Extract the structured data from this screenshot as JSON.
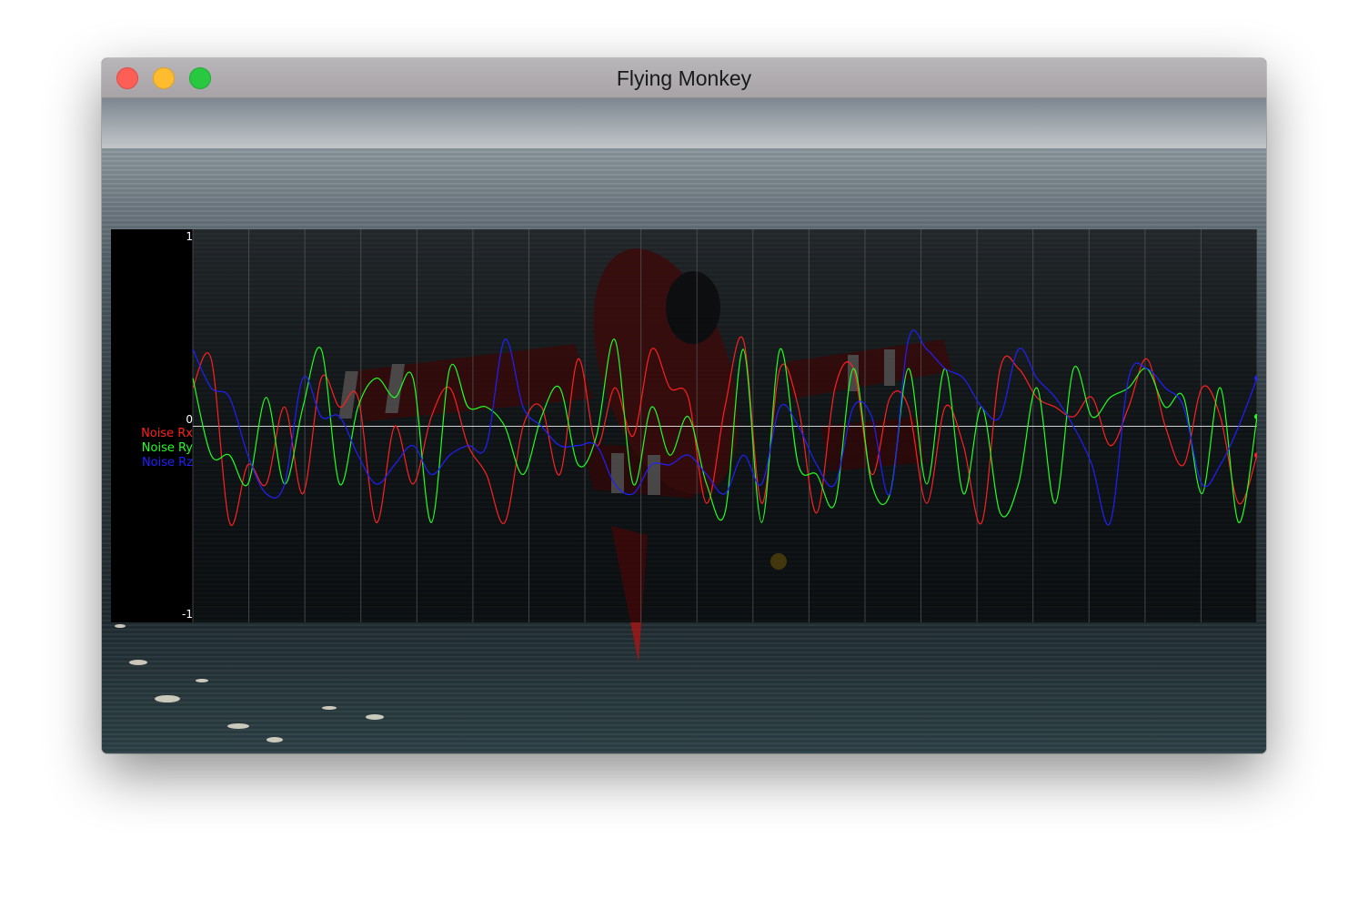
{
  "window": {
    "title": "Flying Monkey"
  },
  "chart_data": {
    "type": "line",
    "yticks": [
      "1",
      "0",
      "-1"
    ],
    "ylim": [
      -1,
      1
    ],
    "x": [
      0,
      1,
      2,
      3,
      4,
      5,
      6,
      7,
      8,
      9,
      10,
      11,
      12,
      13,
      14,
      15,
      16,
      17,
      18,
      19,
      20,
      21,
      22,
      23,
      24,
      25,
      26,
      27,
      28,
      29,
      30,
      31,
      32,
      33,
      34,
      35,
      36,
      37,
      38,
      39,
      40,
      41,
      42,
      43,
      44,
      45,
      46,
      47,
      48,
      49,
      50,
      51,
      52,
      53,
      54,
      55,
      56,
      57,
      58
    ],
    "grid": "vertical lines, zero baseline",
    "legend_placement": "left",
    "series": [
      {
        "name": "Noise Rx",
        "color": "#ff2020",
        "values": [
          0.2,
          0.35,
          -0.5,
          -0.2,
          -0.3,
          0.1,
          -0.35,
          0.25,
          0.1,
          0.15,
          -0.5,
          0.0,
          -0.3,
          0.05,
          0.2,
          -0.1,
          -0.25,
          -0.5,
          0.0,
          0.1,
          -0.25,
          0.35,
          -0.1,
          0.2,
          -0.05,
          0.4,
          0.2,
          0.15,
          -0.4,
          0.1,
          0.45,
          -0.4,
          0.3,
          0.1,
          -0.45,
          0.2,
          0.3,
          -0.25,
          0.15,
          0.1,
          -0.4,
          0.1,
          -0.1,
          -0.5,
          0.3,
          0.3,
          0.15,
          0.1,
          0.05,
          0.15,
          -0.1,
          0.1,
          0.35,
          0.0,
          -0.2,
          0.2,
          0.05,
          -0.4,
          -0.15
        ]
      },
      {
        "name": "Noise Ry",
        "color": "#20ff20",
        "values": [
          0.25,
          -0.15,
          -0.15,
          -0.3,
          0.15,
          -0.3,
          0.1,
          0.4,
          -0.3,
          0.1,
          0.25,
          0.15,
          0.25,
          -0.5,
          0.3,
          0.1,
          0.1,
          0.0,
          -0.25,
          0.05,
          0.2,
          -0.2,
          -0.05,
          0.45,
          -0.3,
          0.1,
          -0.15,
          0.05,
          -0.3,
          -0.45,
          0.4,
          -0.5,
          0.4,
          -0.2,
          -0.25,
          -0.4,
          0.3,
          -0.3,
          -0.35,
          0.3,
          -0.3,
          0.3,
          -0.35,
          0.1,
          -0.45,
          -0.3,
          0.2,
          -0.4,
          0.3,
          0.05,
          0.15,
          0.2,
          0.3,
          0.1,
          0.15,
          -0.35,
          0.2,
          -0.5,
          0.05
        ]
      },
      {
        "name": "Noise Rz",
        "color": "#2020ff",
        "values": [
          0.4,
          0.2,
          0.15,
          -0.15,
          -0.35,
          -0.3,
          0.25,
          0.05,
          0.05,
          -0.15,
          -0.3,
          -0.2,
          -0.1,
          -0.25,
          -0.15,
          -0.1,
          -0.1,
          0.45,
          0.1,
          0.0,
          -0.1,
          -0.1,
          -0.1,
          -0.3,
          -0.35,
          -0.2,
          -0.2,
          -0.15,
          -0.25,
          -0.35,
          -0.15,
          -0.3,
          0.1,
          0.0,
          -0.2,
          -0.3,
          0.1,
          0.05,
          -0.35,
          0.45,
          0.4,
          0.3,
          0.25,
          0.1,
          0.05,
          0.4,
          0.25,
          0.15,
          0.0,
          -0.2,
          -0.5,
          0.25,
          0.3,
          0.2,
          0.1,
          -0.3,
          -0.2,
          0.0,
          0.25
        ]
      }
    ]
  }
}
